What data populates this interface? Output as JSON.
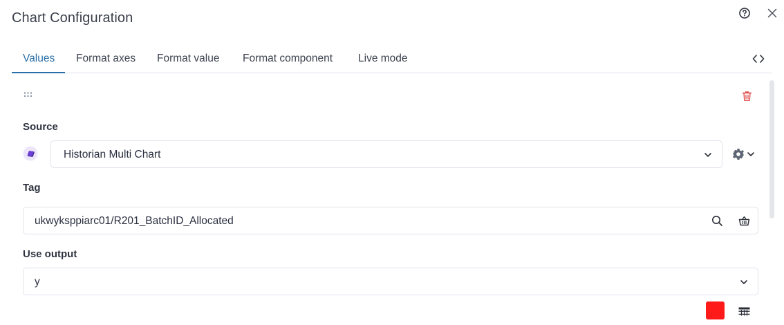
{
  "dialog": {
    "title": "Chart Configuration"
  },
  "tabs": [
    {
      "label": "Values",
      "active": true
    },
    {
      "label": "Format axes",
      "active": false
    },
    {
      "label": "Format value",
      "active": false
    },
    {
      "label": "Format component",
      "active": false
    },
    {
      "label": "Live mode",
      "active": false
    }
  ],
  "source": {
    "label": "Source",
    "value": "Historian Multi Chart",
    "icon": "source-cube-icon"
  },
  "tag": {
    "label": "Tag",
    "value": "ukwyksppiarc01/R201_BatchID_Allocated"
  },
  "use_output": {
    "label": "Use output",
    "value": "y"
  },
  "series_color": "#ff1a1a",
  "colors": {
    "accent": "#2a6fa8",
    "danger": "#e04a4a",
    "text": "#2b3040",
    "border": "#dfe3ea"
  }
}
